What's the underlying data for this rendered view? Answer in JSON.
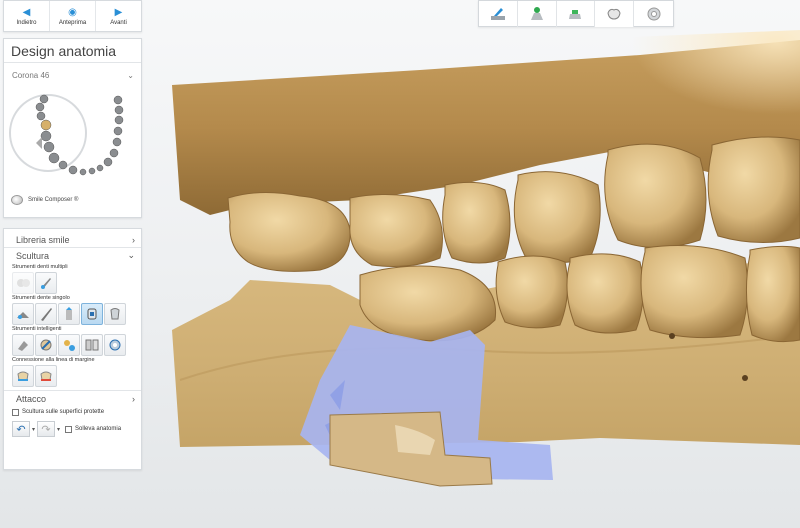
{
  "nav": {
    "back_label": "Indietro",
    "preview_label": "Anteprima",
    "forward_label": "Avanti"
  },
  "design": {
    "title": "Design anatomia",
    "crown_label": "Corona 46",
    "smile_composer_label": "Smile Composer ®"
  },
  "sections": {
    "smile_library": "Libreria smile",
    "sculpt": "Scultura",
    "multi_tools": "Strumenti denti multipli",
    "single_tools": "Strumenti dente singolo",
    "smart_tools": "Strumenti intelligenti",
    "margin_connection": "Connessione alla linea di margine",
    "attachment": "Attacco",
    "sculpt_protected": "Scultura sulle superfici protette",
    "lift_anatomy": "Solleva anatomia"
  },
  "workflow_steps": [
    "scan-step-icon",
    "model-step-icon",
    "margin-step-icon",
    "crown-design-step-icon",
    "finish-step-icon"
  ],
  "colors": {
    "accent": "#2a8fd6",
    "tooth": "#d9b77e",
    "protected_area": "#a7b4f0",
    "panel_bg": "#ffffff"
  }
}
